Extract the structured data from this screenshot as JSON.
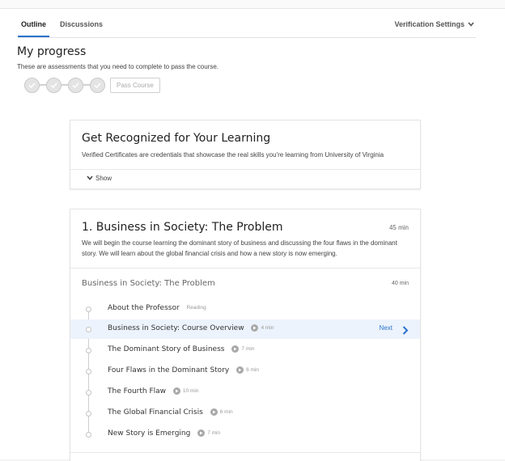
{
  "tabs": [
    {
      "label": "Outline",
      "active": true
    },
    {
      "label": "Discussions",
      "active": false
    }
  ],
  "verification_settings": {
    "label": "Verification Settings",
    "icon": "chevron-down-icon"
  },
  "progress": {
    "title": "My progress",
    "subtitle": "These are assessments that you need to complete to pass the course.",
    "steps": 4,
    "pass_course_label": "Pass Course"
  },
  "recognition": {
    "title": "Get Recognized for Your Learning",
    "description": "Verified Certificates are credentials that showcase the real skills you're learning from University of Virginia",
    "show_label": "Show"
  },
  "module": {
    "title": "1. Business in Society: The Problem",
    "duration": "45 min",
    "description": "We will begin the course learning the dominant story of business and discussing the four flaws in the dominant story.  We will learn about the global financial crisis and how a new story is now emerging.",
    "lesson": {
      "title": "Business in Society: The Problem",
      "duration": "40 min",
      "items": [
        {
          "label": "About the Professor",
          "meta": "Reading",
          "type": "reading",
          "active": false
        },
        {
          "label": "Business in Society: Course Overview",
          "meta": "4 min",
          "type": "video",
          "active": true
        },
        {
          "label": "The Dominant Story of Business",
          "meta": "7 min",
          "type": "video",
          "active": false
        },
        {
          "label": "Four Flaws in the Dominant Story",
          "meta": "6 min",
          "type": "video",
          "active": false
        },
        {
          "label": "The Fourth Flaw",
          "meta": "10 min",
          "type": "video",
          "active": false
        },
        {
          "label": "The Global Financial Crisis",
          "meta": "6 min",
          "type": "video",
          "active": false
        },
        {
          "label": "New Story is Emerging",
          "meta": "7 min",
          "type": "video",
          "active": false
        }
      ],
      "next_label": "Next"
    }
  },
  "colors": {
    "accent": "#2a73cc",
    "active_row": "#ecf3fc"
  }
}
